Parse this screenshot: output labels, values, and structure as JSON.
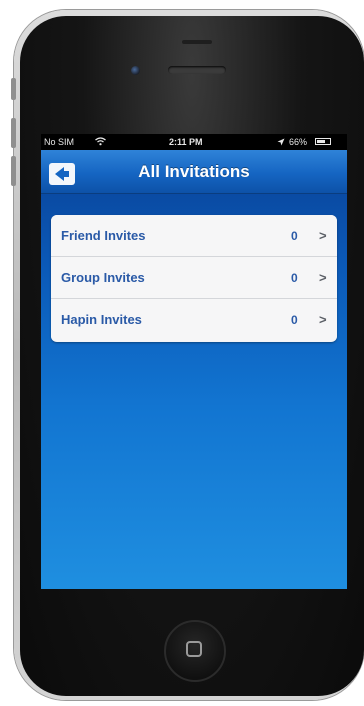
{
  "status_bar": {
    "carrier": "No SIM",
    "wifi_icon": "wifi-icon",
    "time": "2:11 PM",
    "location_icon": "location-arrow-icon",
    "battery_percent": "66%",
    "battery_icon": "battery-icon"
  },
  "nav": {
    "title": "All Invitations",
    "back_icon": "back-arrow-icon"
  },
  "invites": [
    {
      "label": "Friend Invites",
      "count": "0"
    },
    {
      "label": "Group Invites",
      "count": "0"
    },
    {
      "label": "Hapin Invites",
      "count": "0"
    }
  ],
  "chevron_glyph": ">",
  "colors": {
    "nav_blue": "#1565c2",
    "background_blue": "#1275d1",
    "row_text": "#2a5aa7"
  }
}
